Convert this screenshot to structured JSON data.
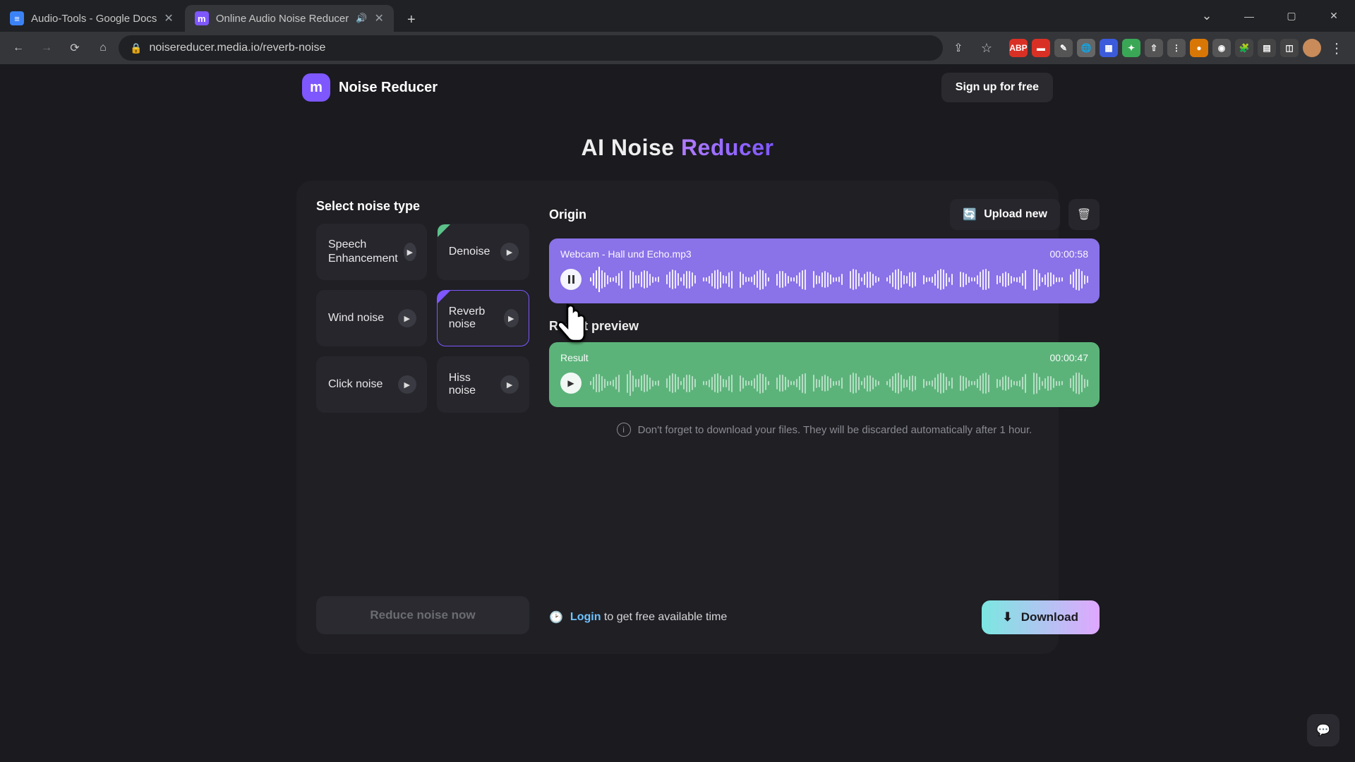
{
  "browser": {
    "tabs": [
      {
        "title": "Audio-Tools - Google Docs",
        "favicon": "gdocs",
        "active": false
      },
      {
        "title": "Online Audio Noise Reducer",
        "favicon": "nr",
        "active": true,
        "sound": true
      }
    ],
    "url": "noisereducer.media.io/reverb-noise"
  },
  "header": {
    "brand": "Noise Reducer",
    "signup": "Sign up for free"
  },
  "main_title_a": "AI Noise ",
  "main_title_b": "Reducer",
  "sidebar": {
    "heading": "Select noise type",
    "types": [
      {
        "label": "Speech Enhancement"
      },
      {
        "label": "Denoise"
      },
      {
        "label": "Wind noise"
      },
      {
        "label": "Reverb noise"
      },
      {
        "label": "Click noise"
      },
      {
        "label": "Hiss noise"
      }
    ],
    "reduce_label": "Reduce noise now"
  },
  "origin": {
    "heading": "Origin",
    "upload_label": "Upload new",
    "filename": "Webcam - Hall und Echo.mp3",
    "duration": "00:00:58"
  },
  "result": {
    "heading": "Result preview",
    "label": "Result",
    "duration": "00:00:47"
  },
  "hint": "Don't forget to download your files. They will be discarded automatically after 1 hour.",
  "footer": {
    "login_word": "Login",
    "login_rest": " to get free available time",
    "download": "Download"
  }
}
